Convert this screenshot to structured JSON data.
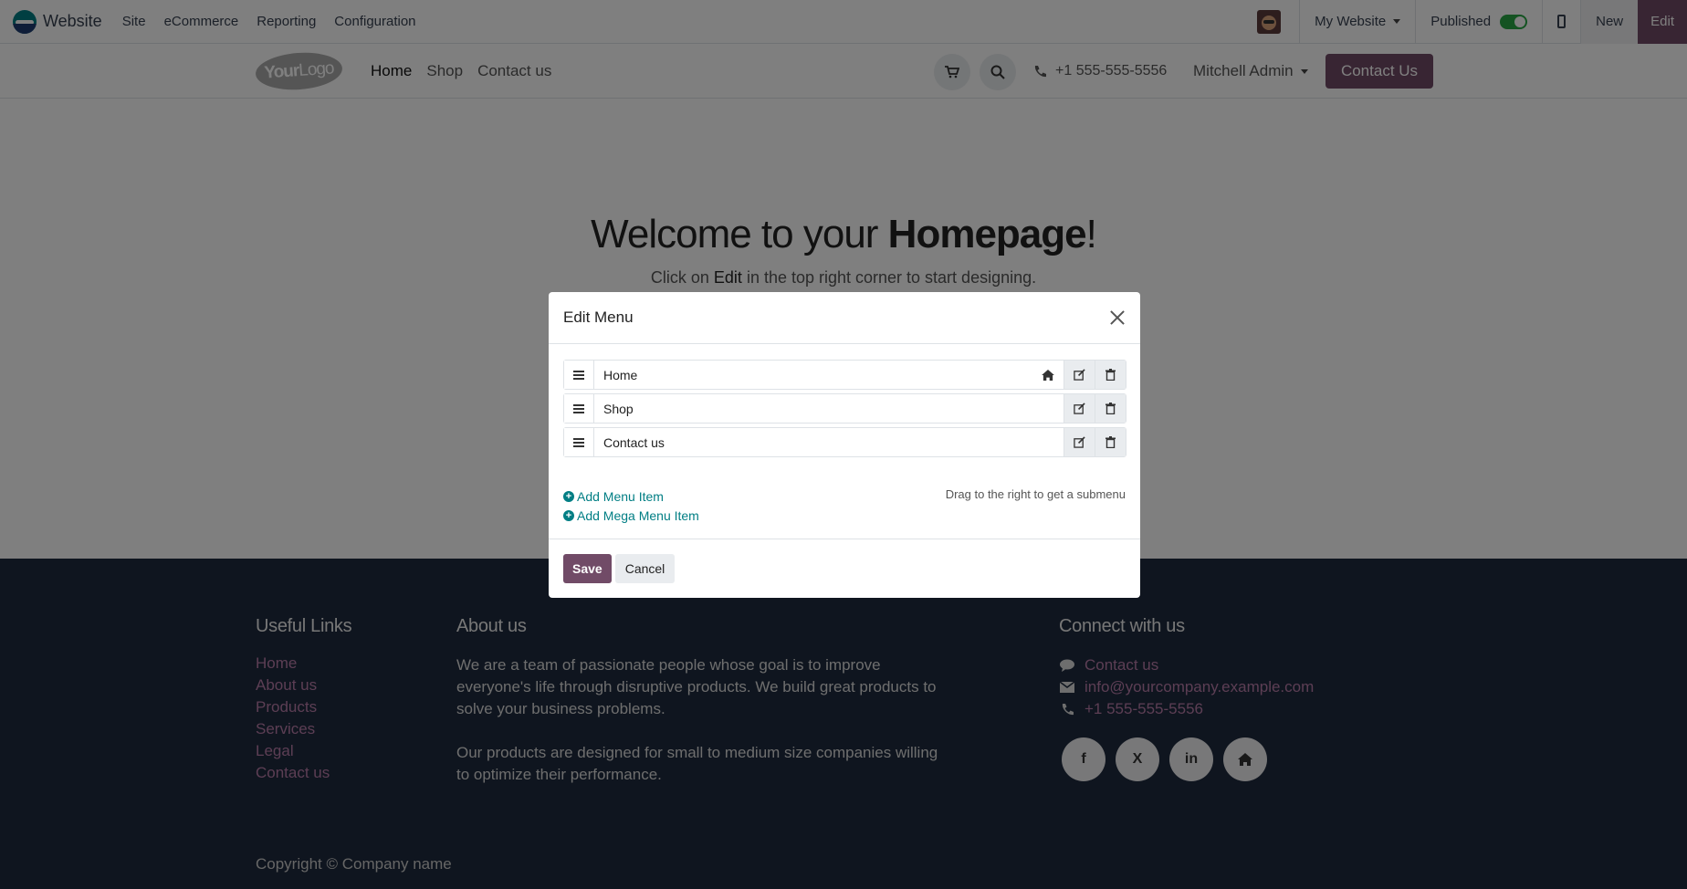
{
  "topbar": {
    "app_name": "Website",
    "menu": [
      "Site",
      "eCommerce",
      "Reporting",
      "Configuration"
    ],
    "website_selector": "My Website",
    "published_label": "Published",
    "new_label": "New",
    "edit_label": "Edit"
  },
  "site_header": {
    "logo_text_bold": "Your",
    "logo_text_thin": "Logo",
    "nav": [
      "Home",
      "Shop",
      "Contact us"
    ],
    "phone": "+1 555-555-5556",
    "user": "Mitchell Admin",
    "cta": "Contact Us"
  },
  "hero": {
    "title_pre": "Welcome to your ",
    "title_bold": "Homepage",
    "title_post": "!",
    "sub_pre": "Click on ",
    "sub_bold": "Edit",
    "sub_post": " in the top right corner to start designing."
  },
  "modal": {
    "title": "Edit Menu",
    "items": [
      {
        "label": "Home",
        "is_home": true
      },
      {
        "label": "Shop",
        "is_home": false
      },
      {
        "label": "Contact us",
        "is_home": false
      }
    ],
    "add_item": "Add Menu Item",
    "add_mega": "Add Mega Menu Item",
    "hint": "Drag to the right to get a submenu",
    "save": "Save",
    "cancel": "Cancel"
  },
  "footer": {
    "useful_links_title": "Useful Links",
    "useful_links": [
      "Home",
      "About us",
      "Products",
      "Services",
      "Legal",
      "Contact us"
    ],
    "about_title": "About us",
    "about_p1": "We are a team of passionate people whose goal is to improve everyone's life through disruptive products. We build great products to solve your business problems.",
    "about_p2": "Our products are designed for small to medium size companies willing to optimize their performance.",
    "connect_title": "Connect with us",
    "connect_contact": "Contact us",
    "connect_email": "info@yourcompany.example.com",
    "connect_phone": "+1 555-555-5556",
    "socials": [
      "f",
      "X",
      "in",
      "home"
    ],
    "copyright": "Copyright © Company name"
  },
  "colors": {
    "brand": "#714b67",
    "accent": "#017e84",
    "footer_bg": "#1f2b3e"
  }
}
